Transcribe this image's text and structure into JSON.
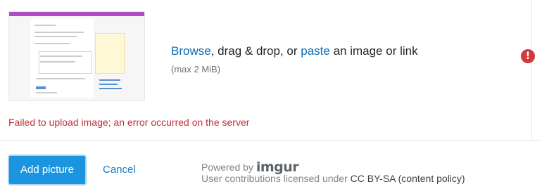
{
  "upload": {
    "browse_label": "Browse",
    "prompt_middle": ", drag & drop, or ",
    "paste_label": "paste",
    "prompt_end": " an image or link",
    "size_limit": "(max 2 MiB)",
    "error_icon": "!",
    "error_icon_name": "alert-circle-icon",
    "error_message": "Failed to upload image; an error occurred on the server"
  },
  "footer": {
    "add_picture_label": "Add picture",
    "cancel_label": "Cancel",
    "powered_by": "Powered by ",
    "brand": "imgur",
    "license_prefix": "User contributions licensed under ",
    "license_link": "CC BY-SA",
    "policy_link": "(content policy)"
  },
  "colors": {
    "primary": "#1b95e0",
    "link": "#0a6cb5",
    "error": "#c22e32",
    "error_icon": "#d0393e"
  }
}
